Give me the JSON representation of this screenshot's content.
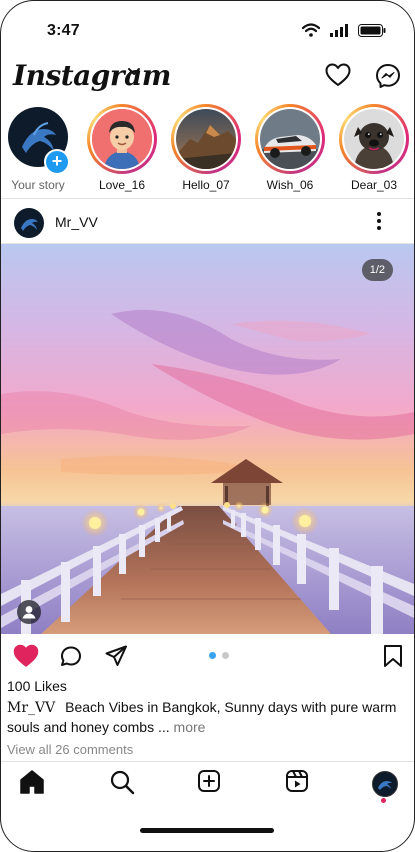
{
  "status_bar": {
    "time": "3:47"
  },
  "header": {
    "logo": "Instagram"
  },
  "stories": [
    {
      "label": "Your story",
      "kind": "own",
      "avatar": "dragon-logo"
    },
    {
      "label": "Love_16",
      "kind": "story",
      "avatar": "cartoon-man"
    },
    {
      "label": "Hello_07",
      "kind": "story",
      "avatar": "mountain"
    },
    {
      "label": "Wish_06",
      "kind": "story",
      "avatar": "race-car"
    },
    {
      "label": "Dear_03",
      "kind": "story",
      "avatar": "pug-dog"
    }
  ],
  "post": {
    "username": "Mr_VV",
    "image_counter": "1/2",
    "image_index": 1,
    "image_count": 2,
    "liked": true,
    "likes": "100 Likes",
    "caption_user": "Mr_VV",
    "caption_text": "Beach Vibes in Bangkok, Sunny days with pure warm souls and honey combs ...",
    "more": "more",
    "view_comments": "View all 26 comments"
  },
  "nav": [
    "home-icon",
    "search-icon",
    "create-icon",
    "reels-icon",
    "profile-avatar"
  ],
  "colors": {
    "like": "#e0245e",
    "accent": "#3aa3ef",
    "story_ring": "#dd2a7b",
    "plus": "#1e9bf0"
  }
}
